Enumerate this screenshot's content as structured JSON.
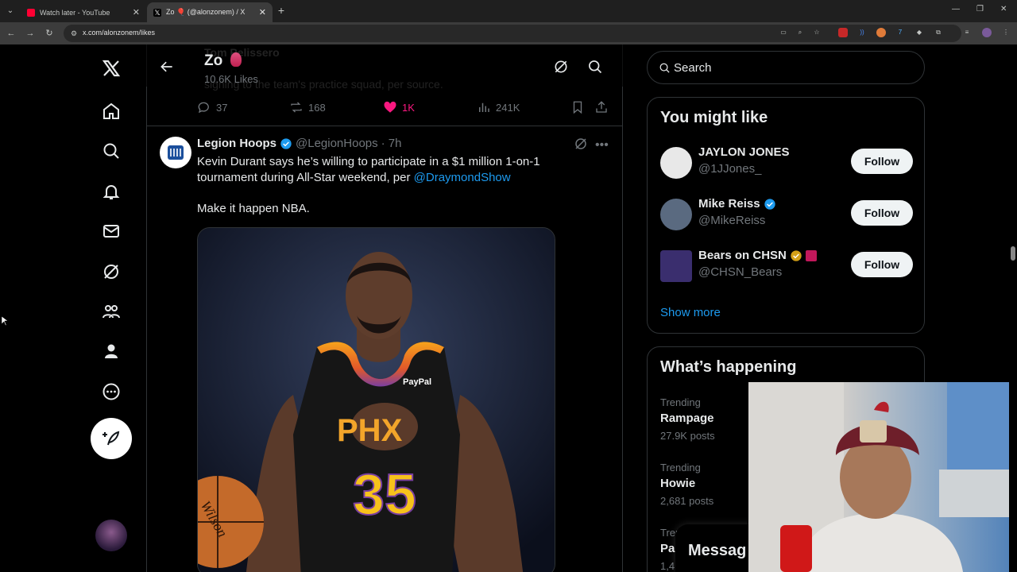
{
  "browser": {
    "tabs": [
      {
        "title": "Watch later - YouTube",
        "active": false,
        "favicon_color": "#ff0033"
      },
      {
        "title": "Zo 🎈 (@alonzonem) / X",
        "active": true,
        "favicon_color": "#ffffff"
      }
    ],
    "url": "x.com/alonzonem/likes"
  },
  "header": {
    "name": "Zo",
    "subtitle": "10.6K Likes",
    "ghost_text": "Tom Pelissero",
    "ghost_text2": "signing to the team's practice squad, per source."
  },
  "prev_tweet_actions": {
    "replies": "37",
    "reposts": "168",
    "likes": "1K",
    "views": "241K"
  },
  "tweet": {
    "name": "Legion Hoops",
    "handle": "@LegionHoops",
    "time": "· 7h",
    "text_before_mention": "Kevin Durant says he’s willing to participate in a $1 million 1-on-1 tournament during All-Star weekend, per ",
    "mention": "@DraymondShow",
    "text2": "Make it happen NBA.",
    "jersey": {
      "brand": "PayPal",
      "number": "35",
      "team": "PHX"
    },
    "ball_text": "Wilson"
  },
  "right": {
    "search_placeholder": "Search",
    "who_to_follow_title": "You might like",
    "suggestions": [
      {
        "name": "JAYLON JONES",
        "handle": "@1JJones_",
        "follow": "Follow",
        "avatar_color": "#e8e8e8"
      },
      {
        "name": "Mike Reiss",
        "handle": "@MikeReiss",
        "follow": "Follow",
        "avatar_color": "#5a6a80"
      },
      {
        "name": "Bears on CHSN",
        "handle": "@CHSN_Bears",
        "follow": "Follow",
        "avatar_color": "#3a2e6e"
      }
    ],
    "show_more": "Show more",
    "whats_happening_title": "What’s happening",
    "trends": [
      {
        "label": "Trending",
        "name": "Rampage",
        "count": "27.9K posts"
      },
      {
        "label": "Trending",
        "name": "Howie",
        "count": "2,681 posts"
      },
      {
        "label": "Trendi",
        "name": "Pa",
        "count": "1,4"
      }
    ],
    "messages_title": "Messag"
  }
}
